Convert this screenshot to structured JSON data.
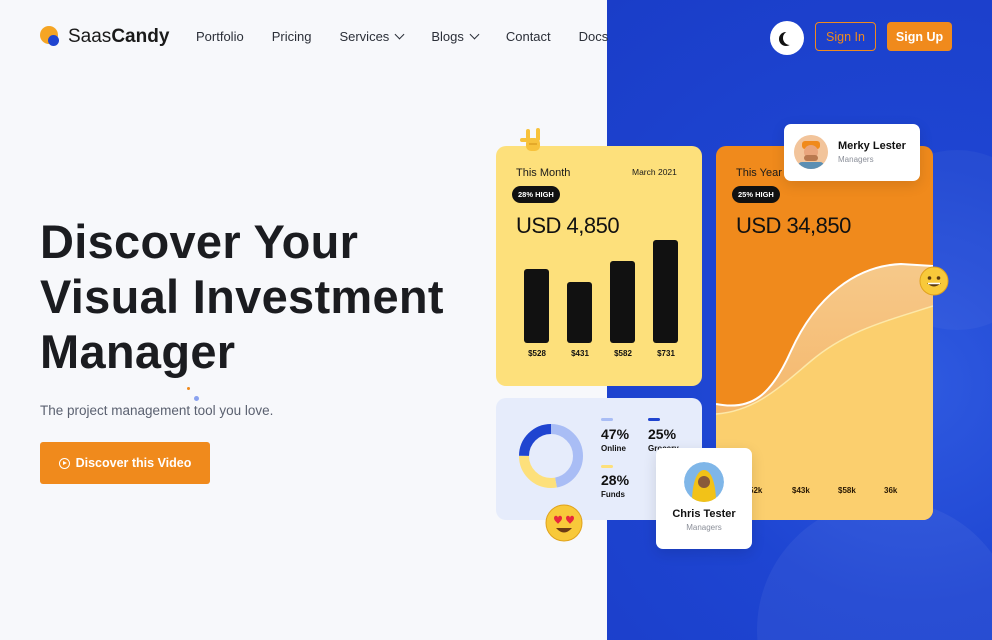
{
  "brand": {
    "name_light": "Saas",
    "name_bold": "Candy"
  },
  "nav": {
    "items": [
      {
        "label": "Portfolio"
      },
      {
        "label": "Pricing"
      },
      {
        "label": "Services"
      },
      {
        "label": "Blogs"
      },
      {
        "label": "Contact"
      },
      {
        "label": "Docs"
      }
    ]
  },
  "header": {
    "signin_label": "Sign In",
    "signup_label": "Sign Up",
    "theme_icon": "moon-icon"
  },
  "hero": {
    "title_line1": "Discover Your",
    "title_line2": "Visual Investment",
    "title_line3": "Manager",
    "subtitle": "The project management tool you love.",
    "cta_label": "Discover this Video"
  },
  "month_card": {
    "title": "This Month",
    "date": "March 2021",
    "badge": "28% HIGH",
    "amount": "USD 4,850",
    "bars": [
      {
        "label": "$528",
        "value": 528
      },
      {
        "label": "$431",
        "value": 431
      },
      {
        "label": "$582",
        "value": 582
      },
      {
        "label": "$731",
        "value": 731
      }
    ]
  },
  "year_card": {
    "title": "This Year",
    "badge": "25% HIGH",
    "amount": "USD 34,850",
    "labels": [
      "52k",
      "$43k",
      "$58k",
      "36k"
    ]
  },
  "donut_card": {
    "stats": [
      {
        "pct": "47%",
        "name": "Online",
        "color": "#a9bdf5"
      },
      {
        "pct": "25%",
        "name": "Grocery",
        "color": "#1f44d0"
      },
      {
        "pct": "28%",
        "name": "Funds",
        "color": "#fde07b"
      }
    ]
  },
  "people": [
    {
      "name": "Merky Lester",
      "role": "Managers"
    },
    {
      "name": "Chris Tester",
      "role": "Managers"
    }
  ],
  "colors": {
    "accent": "#f08a1c",
    "blue": "#1e45d2",
    "yellow": "#fde07b"
  }
}
